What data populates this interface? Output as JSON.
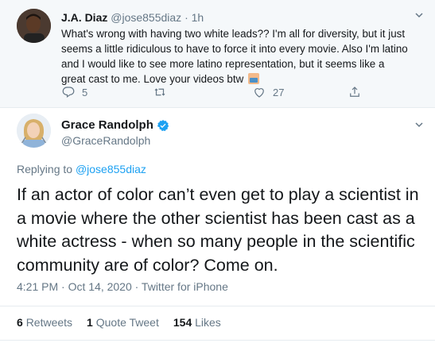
{
  "parent_tweet": {
    "display_name": "J.A. Diaz",
    "handle": "@jose855diaz",
    "separator": "·",
    "time": "1h",
    "text": "What's wrong with having two white leads?? I'm all for diversity, but it just seems a little ridiculous to have to force it into every movie. Also I'm latino and I would like to see more latino representation, but it seems like a great cast to me. Love your videos btw",
    "emoji_icon": "person-emoji-icon",
    "actions": {
      "reply_count": "5",
      "retweet_count": "",
      "like_count": "27"
    }
  },
  "main_tweet": {
    "display_name": "Grace Randolph",
    "handle": "@GraceRandolph",
    "verified": true,
    "replying_to_label": "Replying to",
    "replying_to_handle": "@jose855diaz",
    "text": "If an actor of color can’t even get to play a scientist in a movie where the other scientist has been cast as a white actress - when so many people in the scientific community are of color? Come on.",
    "timestamp": "4:21 PM · Oct 14, 2020 · Twitter for iPhone",
    "stats": {
      "retweets_count": "6",
      "retweets_label": "Retweets",
      "quotes_count": "1",
      "quotes_label": "Quote Tweet",
      "likes_count": "154",
      "likes_label": "Likes"
    }
  },
  "colors": {
    "accent": "#1da1f2",
    "secondary_text": "#657786",
    "parent_background": "#f5f8fa"
  }
}
